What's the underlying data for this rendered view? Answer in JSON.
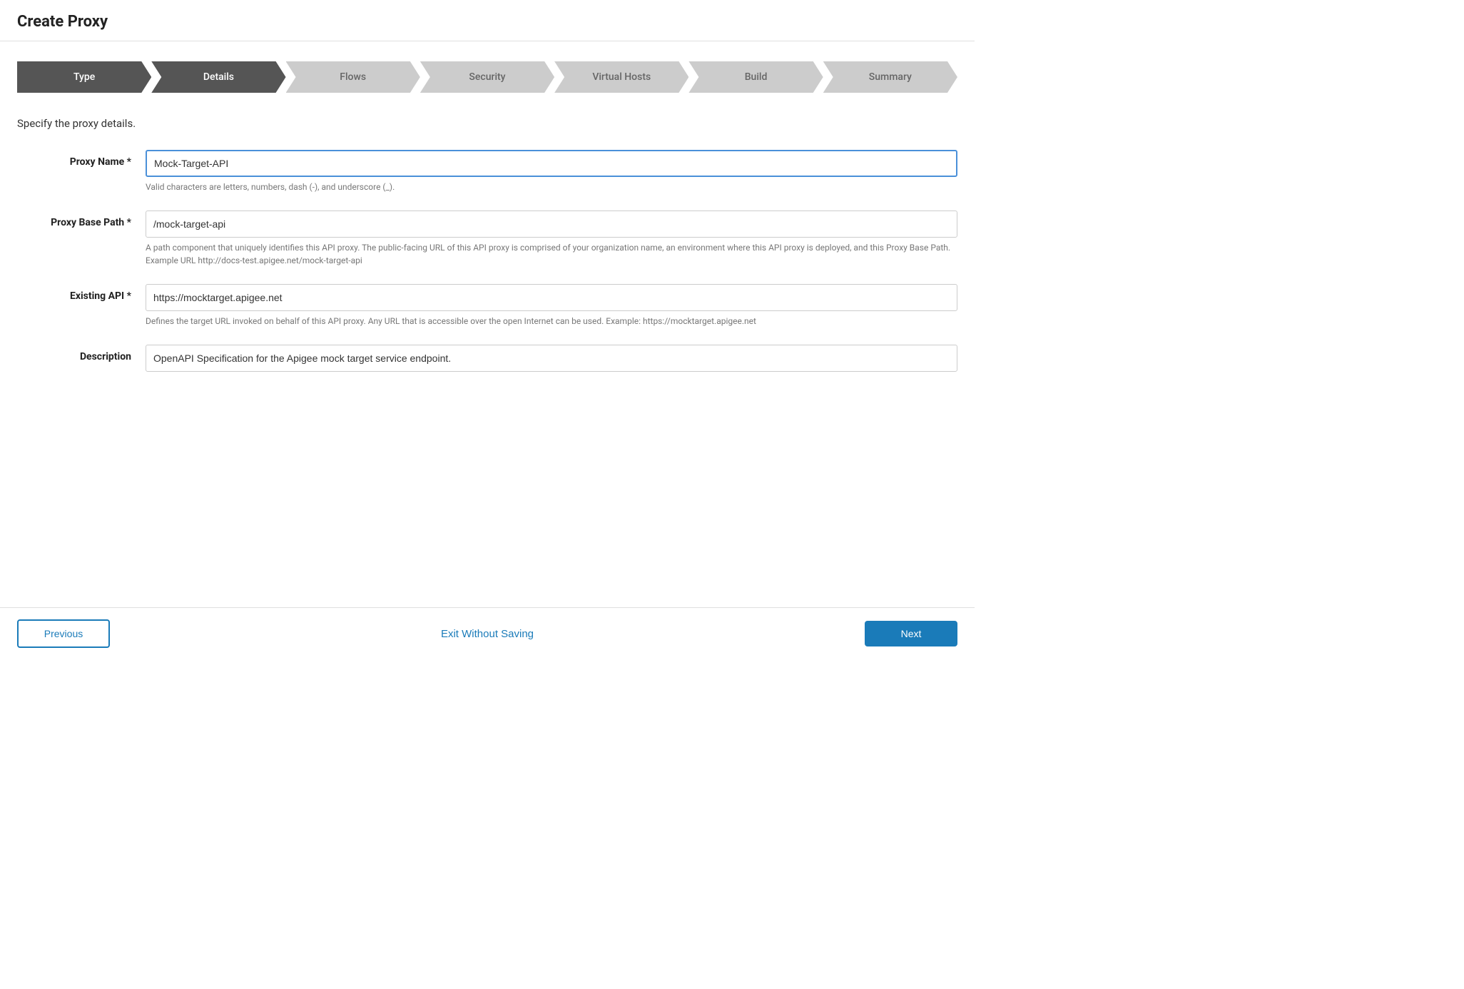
{
  "header": {
    "title": "Create Proxy"
  },
  "stepper": {
    "steps": [
      {
        "id": "type",
        "label": "Type",
        "state": "active"
      },
      {
        "id": "details",
        "label": "Details",
        "state": "current"
      },
      {
        "id": "flows",
        "label": "Flows",
        "state": "inactive"
      },
      {
        "id": "security",
        "label": "Security",
        "state": "inactive"
      },
      {
        "id": "virtual-hosts",
        "label": "Virtual Hosts",
        "state": "inactive"
      },
      {
        "id": "build",
        "label": "Build",
        "state": "inactive"
      },
      {
        "id": "summary",
        "label": "Summary",
        "state": "inactive"
      }
    ]
  },
  "form": {
    "subtitle": "Specify the proxy details.",
    "fields": {
      "proxy_name": {
        "label": "Proxy Name",
        "required": true,
        "value": "Mock-Target-API",
        "hint": "Valid characters are letters, numbers, dash (-), and underscore (_)."
      },
      "proxy_base_path": {
        "label": "Proxy Base Path",
        "required": true,
        "value": "/mock-target-api",
        "hint": "A path component that uniquely identifies this API proxy. The public-facing URL of this API proxy is comprised of your organization name, an environment where this API proxy is deployed, and this Proxy Base Path. Example URL http://docs-test.apigee.net/mock-target-api"
      },
      "existing_api": {
        "label": "Existing API",
        "required": true,
        "value": "https://mocktarget.apigee.net",
        "hint": "Defines the target URL invoked on behalf of this API proxy. Any URL that is accessible over the open Internet can be used. Example: https://mocktarget.apigee.net"
      },
      "description": {
        "label": "Description",
        "required": false,
        "value": "OpenAPI Specification for the Apigee mock target service endpoint.",
        "hint": ""
      }
    }
  },
  "footer": {
    "previous_label": "Previous",
    "exit_label": "Exit Without Saving",
    "next_label": "Next"
  }
}
